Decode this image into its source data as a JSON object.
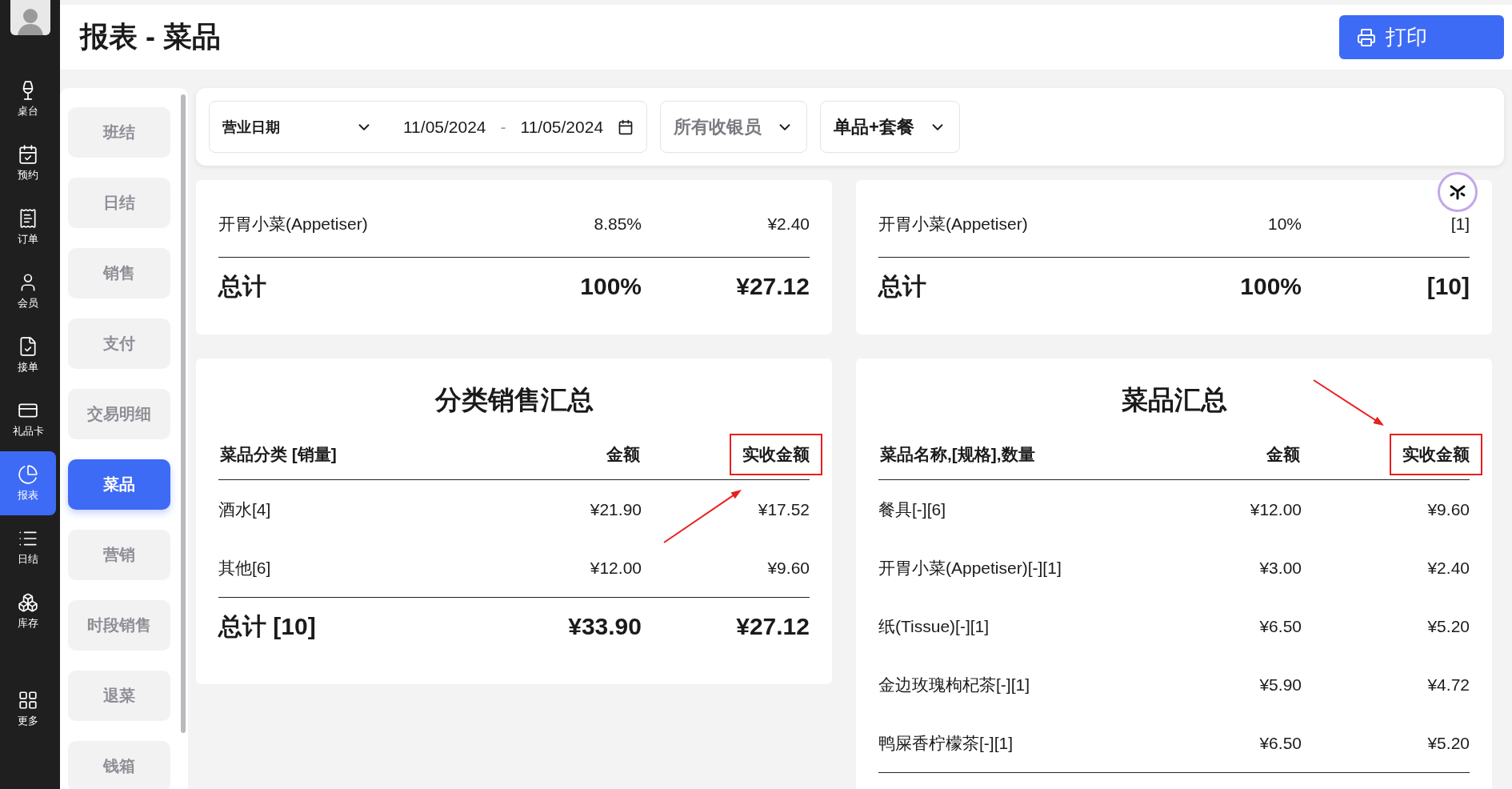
{
  "sidebar": {
    "items": [
      {
        "label": "桌台",
        "selected": false
      },
      {
        "label": "预约",
        "selected": false
      },
      {
        "label": "订单",
        "selected": false
      },
      {
        "label": "会员",
        "selected": false
      },
      {
        "label": "接单",
        "selected": false
      },
      {
        "label": "礼品卡",
        "selected": false
      },
      {
        "label": "报表",
        "selected": true
      },
      {
        "label": "日结",
        "selected": false
      },
      {
        "label": "库存",
        "selected": false
      }
    ],
    "more": {
      "label": "更多"
    }
  },
  "header": {
    "title": "报表 - 菜品",
    "print_button": "打印"
  },
  "report_nav": [
    {
      "label": "班结",
      "selected": false
    },
    {
      "label": "日结",
      "selected": false
    },
    {
      "label": "销售",
      "selected": false
    },
    {
      "label": "支付",
      "selected": false
    },
    {
      "label": "交易明细",
      "selected": false
    },
    {
      "label": "菜品",
      "selected": true
    },
    {
      "label": "营销",
      "selected": false
    },
    {
      "label": "时段销售",
      "selected": false
    },
    {
      "label": "退菜",
      "selected": false
    },
    {
      "label": "钱箱",
      "selected": false
    }
  ],
  "filters": {
    "date_type": "营业日期",
    "date_from": "11/05/2024",
    "date_separator": "-",
    "date_to": "11/05/2024",
    "cashier": "所有收银员",
    "item_type": "单品+套餐"
  },
  "top_left_card": {
    "rows": [
      {
        "name": "开胃小菜(Appetiser)",
        "share": "8.85%",
        "value": "¥2.40"
      }
    ],
    "total": {
      "label": "总计",
      "share": "100%",
      "value": "¥27.12"
    }
  },
  "top_right_card": {
    "rows": [
      {
        "name": "开胃小菜(Appetiser)",
        "share": "10%",
        "value": "[1]"
      }
    ],
    "total": {
      "label": "总计",
      "share": "100%",
      "value": "[10]"
    }
  },
  "category_summary": {
    "title": "分类销售汇总",
    "columns": [
      {
        "label": "菜品分类 [销量]",
        "highlighted": false
      },
      {
        "label": "金额",
        "highlighted": false
      },
      {
        "label": "实收金额",
        "highlighted": true
      }
    ],
    "rows": [
      {
        "name": "酒水[4]",
        "amount": "¥21.90",
        "received": "¥17.52"
      },
      {
        "name": "其他[6]",
        "amount": "¥12.00",
        "received": "¥9.60"
      }
    ],
    "total": {
      "label": "总计 [10]",
      "amount": "¥33.90",
      "received": "¥27.12"
    }
  },
  "dish_summary": {
    "title": "菜品汇总",
    "columns": [
      {
        "label": "菜品名称,[规格],数量",
        "highlighted": false
      },
      {
        "label": "金额",
        "highlighted": false
      },
      {
        "label": "实收金额",
        "highlighted": true
      }
    ],
    "rows": [
      {
        "name": "餐具[-][6]",
        "amount": "¥12.00",
        "received": "¥9.60"
      },
      {
        "name": "开胃小菜(Appetiser)[-][1]",
        "amount": "¥3.00",
        "received": "¥2.40"
      },
      {
        "name": "纸(Tissue)[-][1]",
        "amount": "¥6.50",
        "received": "¥5.20"
      },
      {
        "name": "金边玫瑰枸杞茶[-][1]",
        "amount": "¥5.90",
        "received": "¥4.72"
      },
      {
        "name": "鸭屎香柠檬茶[-][1]",
        "amount": "¥6.50",
        "received": "¥5.20"
      }
    ]
  }
}
